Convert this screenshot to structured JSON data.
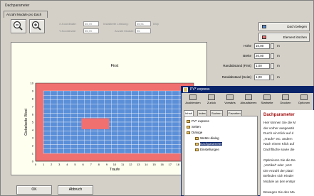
{
  "window": {
    "title": "Dachparameter"
  },
  "tabs": [
    {
      "label": "Anzahl Module pro Dach"
    }
  ],
  "fields": {
    "x_label": "X-Koordinate:",
    "x_value": "35,70",
    "y_label": "Y-Koordinate:",
    "y_value": "35,70",
    "leistung_label": "Installierte Leistung:",
    "leistung_value": "35,91",
    "leistung_unit": "kWp",
    "module_label": "Anzahl Module:",
    "module_value": "95"
  },
  "buttons": {
    "dach_belegen": "Dach belegen",
    "element_loeschen": "Element löschen",
    "ok": "OK",
    "abbruch": "Abbruch"
  },
  "params": [
    {
      "label": "Höhe",
      "value": "10,00",
      "unit": "m"
    },
    {
      "label": "Breite",
      "value": "20,00",
      "unit": "m"
    },
    {
      "label": "Randabstand (First)",
      "value": "1,00",
      "unit": "m"
    },
    {
      "label": "Randabstand (Seite)",
      "value": "1,00",
      "unit": "m"
    }
  ],
  "chart_data": {
    "type": "heatmap",
    "title": "First",
    "xlabel": "Traufe",
    "ylabel": "Giebelseite West",
    "x_ticks": [
      "0",
      "1",
      "2",
      "3",
      "4",
      "5",
      "6",
      "7",
      "8",
      "9",
      "10",
      "11",
      "12",
      "13",
      "14",
      "15",
      "16",
      "17",
      "18",
      "19",
      "20"
    ],
    "y_ticks": [
      "0",
      "1",
      "2",
      "3",
      "4",
      "5",
      "6",
      "7",
      "8",
      "9",
      "10"
    ],
    "roof": {
      "width": 20,
      "height": 10,
      "color": "#f07070"
    },
    "module_area": {
      "x0": 1,
      "x1": 19,
      "y0": 1,
      "y1": 9,
      "cols": 21,
      "rows": 14,
      "color": "#5b8fd8"
    },
    "obstacle": {
      "x0": 5.8,
      "x1": 9.3,
      "y0": 4.1,
      "y1": 5.5,
      "color": "#f07070"
    }
  },
  "help": {
    "title": "PV* express",
    "toolbar": [
      "Ausblenden",
      "Zurück",
      "Vorwärts",
      "Aktualisieren",
      "Startseite",
      "Drucken",
      "Optionen"
    ],
    "tabs": [
      "Inhalt",
      "Index",
      "Suchen",
      "Favoriten"
    ],
    "tree": [
      {
        "label": "PV* express",
        "indent": 0
      },
      {
        "label": "Seiten",
        "indent": 0
      },
      {
        "label": "Dialoge",
        "indent": 0
      },
      {
        "label": "Wetter-dialog",
        "indent": 1
      },
      {
        "label": "Dachparameter",
        "indent": 1
      },
      {
        "label": "Einstellungen",
        "indent": 1
      }
    ],
    "heading": "Dachparameter",
    "lines": [
      "Hier können Sie die M",
      "der vorher ausgewäh",
      "Durch ein Klick auf d",
      "„Traufe\" etc. ändern",
      "Nach einem Klick auf",
      "Dachfläche sowie die",
      "",
      "Optimieren Sie die Ba",
      "„Vertikal\" oder „Vert",
      "Die Anzahl der platzi",
      "Befinden sich Hinder",
      "Module an den entspr",
      "",
      "Bewegen Sie den Ma"
    ]
  },
  "colors": {
    "window_bg": "#d4d0c8",
    "titlebar_active": "#0a246a",
    "roof": "#f07070",
    "module": "#5b8fd8"
  },
  "icons": {
    "zoom_out": "zoom-out-icon",
    "zoom_in": "zoom-in-icon"
  }
}
